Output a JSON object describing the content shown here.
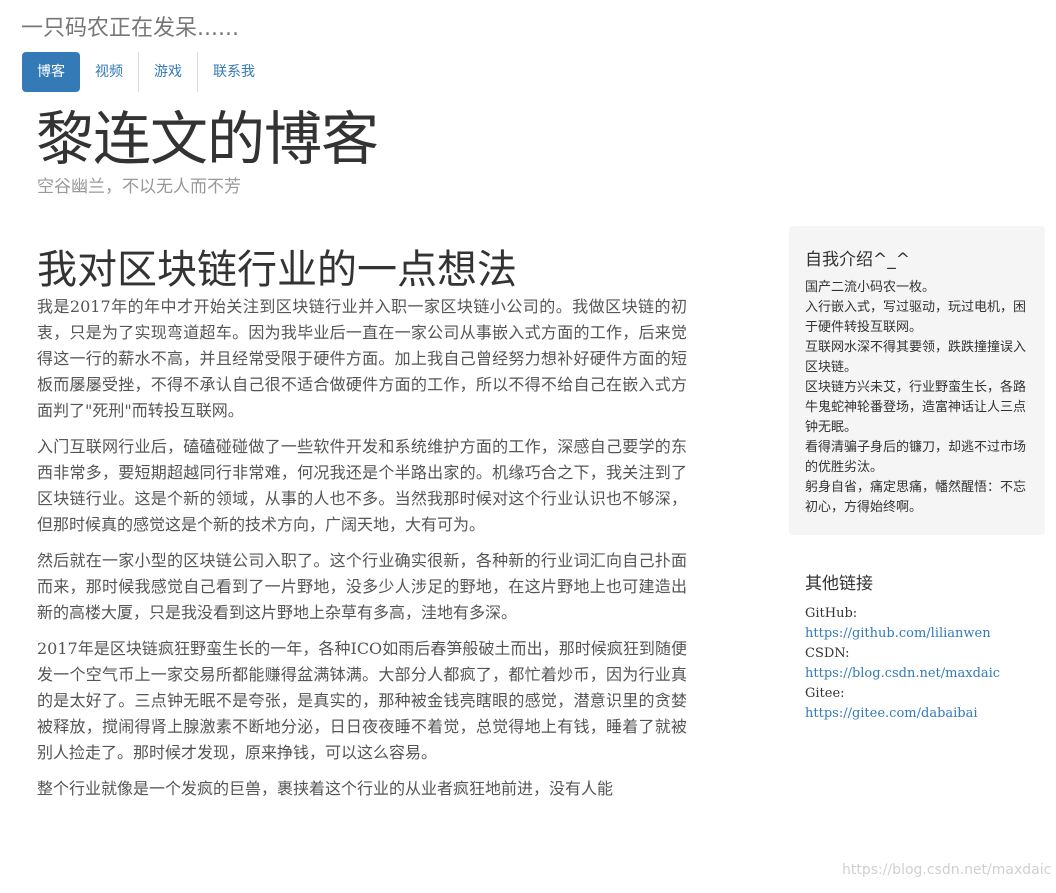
{
  "site": {
    "title": "一只码农正在发呆......"
  },
  "nav": {
    "items": [
      {
        "label": "博客",
        "active": true
      },
      {
        "label": "视频",
        "active": false
      },
      {
        "label": "游戏",
        "active": false
      },
      {
        "label": "联系我",
        "active": false
      }
    ],
    "active_color": "#337ab7"
  },
  "header": {
    "title": "黎连文的博客",
    "subtitle": "空谷幽兰，不以无人而不芳"
  },
  "post": {
    "title": "我对区块链行业的一点想法",
    "paragraphs": [
      "我是2017年的年中才开始关注到区块链行业并入职一家区块链小公司的。我做区块链的初衷，只是为了实现弯道超车。因为我毕业后一直在一家公司从事嵌入式方面的工作，后来觉得这一行的薪水不高，并且经常受限于硬件方面。加上我自己曾经努力想补好硬件方面的短板而屡屡受挫，不得不承认自己很不适合做硬件方面的工作，所以不得不给自己在嵌入式方面判了\"死刑\"而转投互联网。",
      "入门互联网行业后，磕磕碰碰做了一些软件开发和系统维护方面的工作，深感自己要学的东西非常多，要短期超越同行非常难，何况我还是个半路出家的。机缘巧合之下，我关注到了区块链行业。这是个新的领域，从事的人也不多。当然我那时候对这个行业认识也不够深，但那时候真的感觉这是个新的技术方向，广阔天地，大有可为。",
      "然后就在一家小型的区块链公司入职了。这个行业确实很新，各种新的行业词汇向自己扑面而来，那时候我感觉自己看到了一片野地，没多少人涉足的野地，在这片野地上也可建造出新的高楼大厦，只是我没看到这片野地上杂草有多高，洼地有多深。",
      "2017年是区块链疯狂野蛮生长的一年，各种ICO如雨后春笋般破土而出，那时候疯狂到随便发一个空气币上一家交易所都能赚得盆满钵满。大部分人都疯了，都忙着炒币，因为行业真的是太好了。三点钟无眠不是夸张，是真实的，那种被金钱亮瞎眼的感觉，潜意识里的贪婪被释放，搅闹得肾上腺激素不断地分泌，日日夜夜睡不着觉，总觉得地上有钱，睡着了就被别人捡走了。那时候才发现，原来挣钱，可以这么容易。",
      "整个行业就像是一个发疯的巨兽，裹挟着这个行业的从业者疯狂地前进，没有人能"
    ]
  },
  "about": {
    "title": "自我介绍^_^",
    "lines": [
      "国产二流小码农一枚。",
      "入行嵌入式，写过驱动，玩过电机，困于硬件转投互联网。",
      "互联网水深不得其要领，跌跌撞撞误入区块链。",
      "区块链方兴未艾，行业野蛮生长，各路牛鬼蛇神轮番登场，造富神话让人三点钟无眠。",
      "看得清骗子身后的镰刀，却逃不过市场的优胜劣汰。",
      "躬身自省，痛定思痛，幡然醒悟：不忘初心，方得始终啊。"
    ]
  },
  "links": {
    "title": "其他链接",
    "items": [
      {
        "label": "GitHub:",
        "url": "https://github.com/lilianwen"
      },
      {
        "label": "CSDN:",
        "url": "https://blog.csdn.net/maxdaic"
      },
      {
        "label": "Gitee:",
        "url": "https://gitee.com/dabaibai"
      }
    ]
  },
  "watermark": "https://blog.csdn.net/maxdaic"
}
